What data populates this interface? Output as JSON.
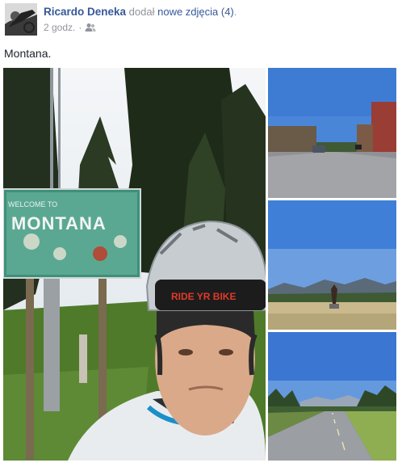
{
  "post": {
    "author": "Ricardo Deneka",
    "action": "dodał",
    "photos_link": "nowe zdjęcia (4)",
    "action_end": ".",
    "time": "2 godz.",
    "separator": "·",
    "audience_icon": "friends-icon",
    "caption": "Montana."
  },
  "photos": {
    "main": {
      "sign_welcome": "WELCOME TO",
      "sign_state": "MONTANA",
      "cap_text": "RIDE YR BIKE"
    }
  },
  "colors": {
    "link": "#365899",
    "meta": "#90949c",
    "sky": "#4a86d8"
  }
}
